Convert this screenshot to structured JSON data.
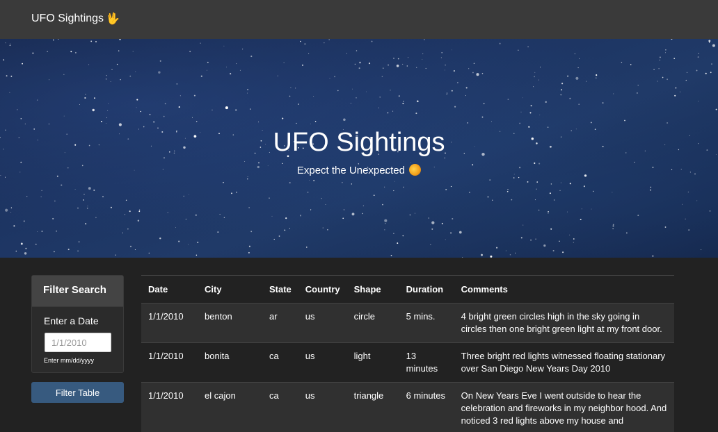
{
  "navbar": {
    "brand": "UFO Sightings",
    "brand_icon": "vulcan-salute-hand-icon"
  },
  "hero": {
    "title": "UFO Sightings",
    "subtitle": "Expect the Unexpected",
    "subtitle_icon": "comet-icon"
  },
  "filter": {
    "heading": "Filter Search",
    "date_label": "Enter a Date",
    "date_placeholder": "1/1/2010",
    "date_help": "Enter mm/dd/yyyy",
    "button_label": "Filter Table"
  },
  "table": {
    "headers": [
      "Date",
      "City",
      "State",
      "Country",
      "Shape",
      "Duration",
      "Comments"
    ],
    "rows": [
      [
        "1/1/2010",
        "benton",
        "ar",
        "us",
        "circle",
        "5 mins.",
        "4 bright green circles high in the sky going in circles then one bright green light at my front door."
      ],
      [
        "1/1/2010",
        "bonita",
        "ca",
        "us",
        "light",
        "13 minutes",
        "Three bright red lights witnessed floating stationary over San Diego New Years Day 2010"
      ],
      [
        "1/1/2010",
        "el cajon",
        "ca",
        "us",
        "triangle",
        "6 minutes",
        "On New Years Eve I went outside to hear the celebration and fireworks in my neighbor hood. And noticed 3 red lights above my house and"
      ]
    ]
  },
  "colors": {
    "navbar_bg": "#3a3a3a",
    "page_bg": "#222222",
    "button_bg": "#375a7f",
    "stripe_bg": "#303030"
  }
}
